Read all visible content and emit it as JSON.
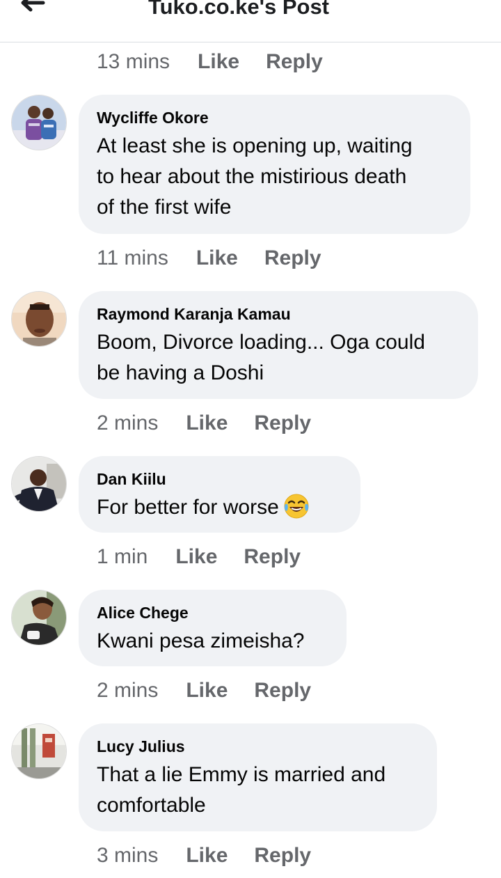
{
  "header": {
    "title": "Tuko.co.ke's Post",
    "back_icon": "arrow-left-icon"
  },
  "top_meta": {
    "time": "13 mins",
    "like": "Like",
    "reply": "Reply"
  },
  "comments": [
    {
      "author": "Wycliffe Okore",
      "lines": [
        "At least she is opening up, waiting",
        "to hear about the mistirious death",
        "of the first wife"
      ],
      "time": "11 mins",
      "like": "Like",
      "reply": "Reply"
    },
    {
      "author": "Raymond Karanja Kamau",
      "lines": [
        "Boom, Divorce loading... Oga could",
        "be having a Doshi"
      ],
      "time": "2 mins",
      "like": "Like",
      "reply": "Reply"
    },
    {
      "author": "Dan Kiilu",
      "lines": [
        "For better for worse"
      ],
      "emoji": "tears-of-joy-emoji-icon",
      "time": "1 min",
      "like": "Like",
      "reply": "Reply"
    },
    {
      "author": "Alice Chege",
      "lines": [
        "Kwani pesa zimeisha?"
      ],
      "time": "2 mins",
      "like": "Like",
      "reply": "Reply"
    },
    {
      "author": "Lucy Julius",
      "lines": [
        "That a lie Emmy is married and",
        "comfortable"
      ],
      "time": "3 mins",
      "like": "Like",
      "reply": "Reply"
    }
  ],
  "colors": {
    "bubble": "#f0f2f5",
    "meta": "#65676b",
    "text": "#050505"
  }
}
